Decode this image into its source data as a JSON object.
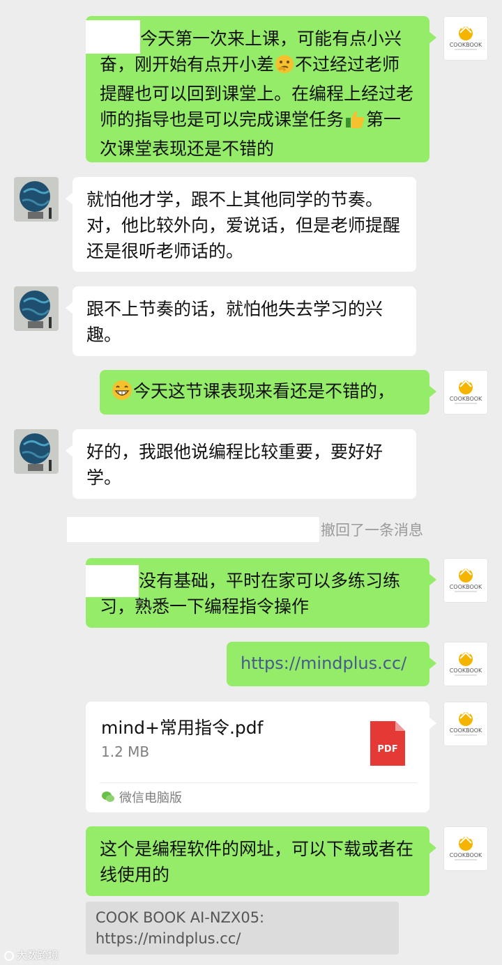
{
  "messages": [
    {
      "side": "right",
      "text": "今天第一次来上课，可能有点小兴奋，刚开始有点开小差",
      "emoji_1": "thinking-face",
      "text_2": "不过经过老师提醒也可以回到课堂上。在编程上经过老师的指导也是可以完成课堂任务",
      "emoji_2": "thumbs-up",
      "text_3": "第一次课堂表现还是不错的"
    },
    {
      "side": "left",
      "text": "就怕他才学，跟不上其他同学的节奏。对，他比较外向，爱说话，但是老师提醒还是很听老师话的。"
    },
    {
      "side": "left",
      "text": "跟不上节奏的话，就怕他失去学习的兴趣。"
    },
    {
      "side": "right",
      "emoji": "grinning-face",
      "text": "今天这节课表现来看还是不错的，"
    },
    {
      "side": "left",
      "text": "好的，我跟他说编程比较重要，要好好学。"
    },
    {
      "side": "right",
      "text": "没有基础，平时在家可以多练习练习，熟悉一下编程指令操作"
    },
    {
      "side": "right",
      "text": "https://mindplus.cc/"
    },
    {
      "side": "right",
      "text": "这个是编程软件的网址，可以下载或者在线使用的"
    }
  ],
  "recall_notice": "撤回了一条消息",
  "file": {
    "name": "mind+常用指令.pdf",
    "size": "1.2 MB",
    "icon_label": "PDF",
    "source": "微信电脑版"
  },
  "quote": {
    "line1": "COOK BOOK AI-NZX05:",
    "line2": "https://mindplus.cc/"
  },
  "avatar_self_label": "COOKBOOK",
  "watermark": "大数跨境",
  "colors": {
    "background": "#ededed",
    "bubble_self": "#95ec69",
    "bubble_other": "#ffffff",
    "pdf_red": "#e53935",
    "link": "#465a8c"
  }
}
